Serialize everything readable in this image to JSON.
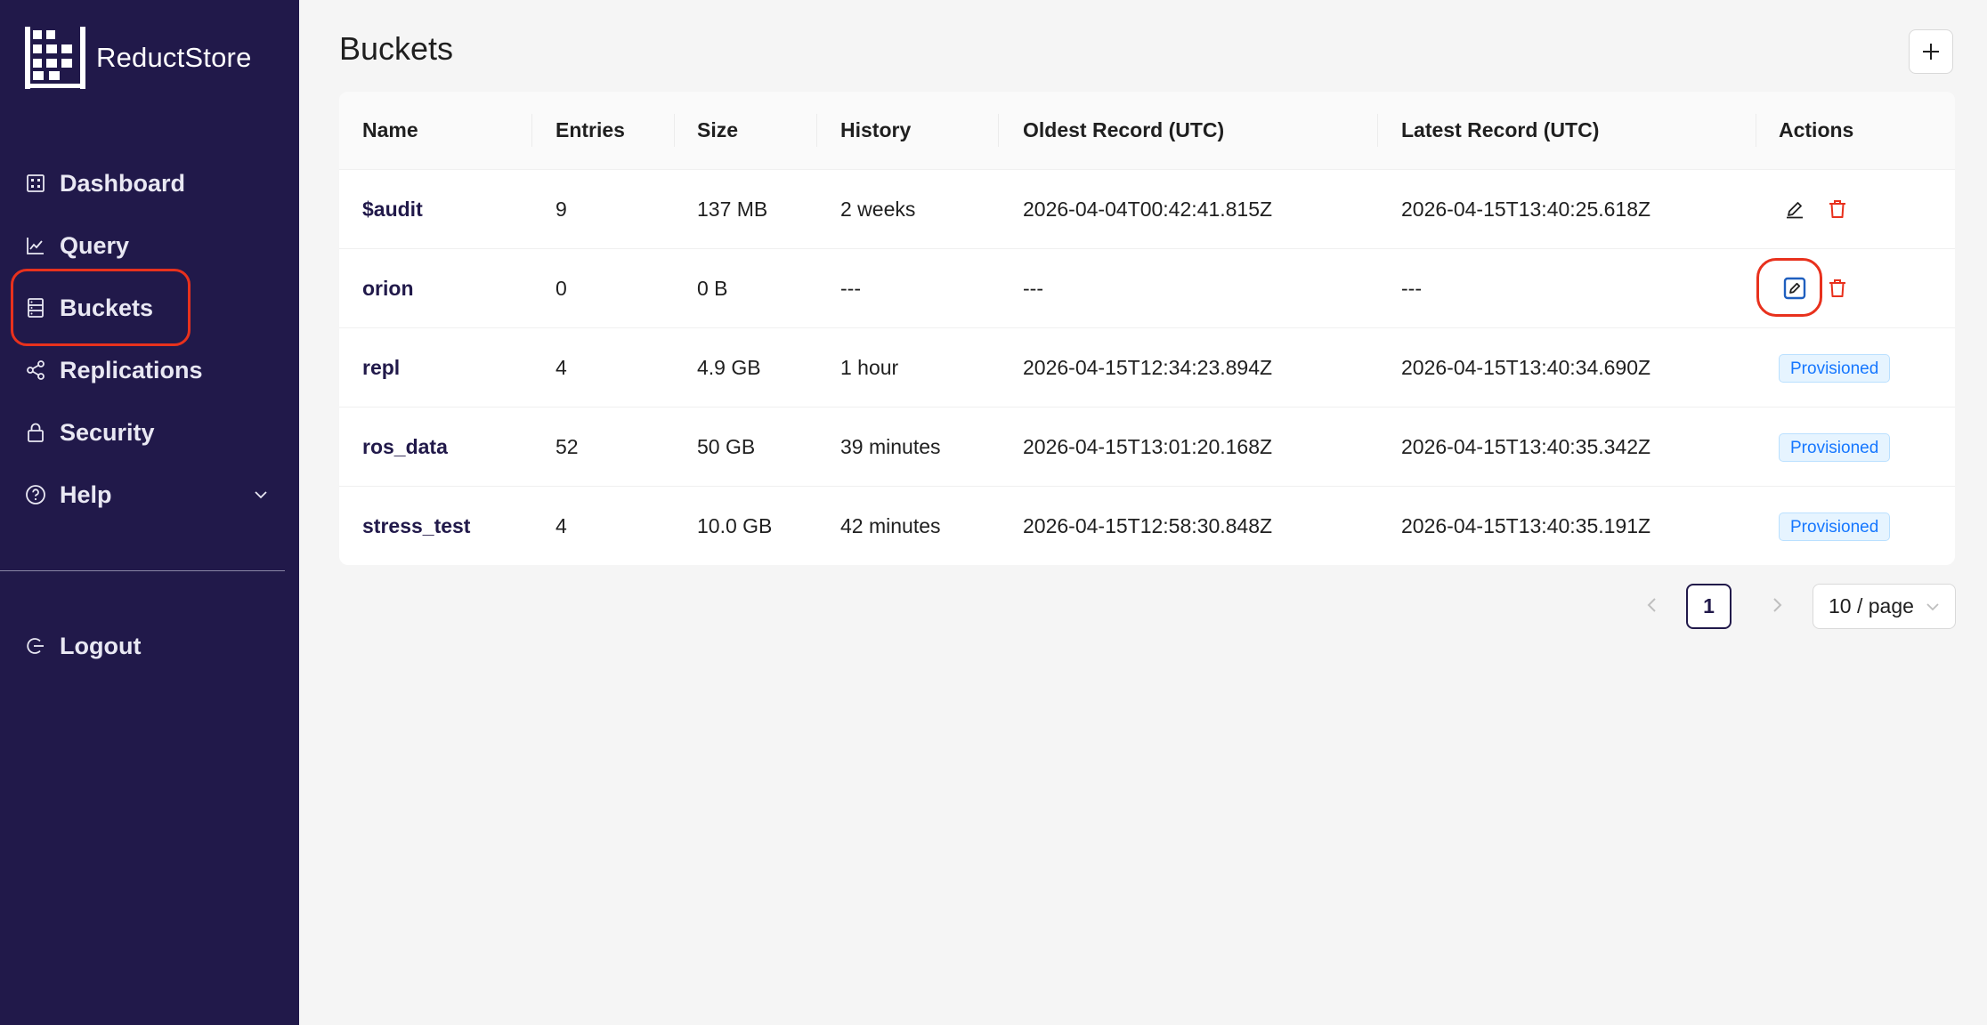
{
  "app": {
    "name": "ReductStore"
  },
  "sidebar": {
    "items": [
      {
        "label": "Dashboard",
        "icon": "dashboard-icon"
      },
      {
        "label": "Query",
        "icon": "line-chart-icon"
      },
      {
        "label": "Buckets",
        "icon": "database-icon"
      },
      {
        "label": "Replications",
        "icon": "share-icon"
      },
      {
        "label": "Security",
        "icon": "lock-icon"
      },
      {
        "label": "Help",
        "icon": "question-circle-icon"
      }
    ],
    "logout": {
      "label": "Logout",
      "icon": "logout-icon"
    },
    "highlighted": "Buckets"
  },
  "page": {
    "title": "Buckets"
  },
  "table": {
    "columns": [
      "Name",
      "Entries",
      "Size",
      "History",
      "Oldest Record (UTC)",
      "Latest Record (UTC)",
      "Actions"
    ],
    "rows": [
      {
        "name": "$audit",
        "entries": "9",
        "size": "137 MB",
        "history": "2 weeks",
        "oldest": "2026-04-04T00:42:41.815Z",
        "latest": "2026-04-15T13:40:25.618Z",
        "action": "edit-delete"
      },
      {
        "name": "orion",
        "entries": "0",
        "size": "0 B",
        "history": "---",
        "oldest": "---",
        "latest": "---",
        "action": "edit-delete"
      },
      {
        "name": "repl",
        "entries": "4",
        "size": "4.9 GB",
        "history": "1 hour",
        "oldest": "2026-04-15T12:34:23.894Z",
        "latest": "2026-04-15T13:40:34.690Z",
        "action": "Provisioned"
      },
      {
        "name": "ros_data",
        "entries": "52",
        "size": "50 GB",
        "history": "39 minutes",
        "oldest": "2026-04-15T13:01:20.168Z",
        "latest": "2026-04-15T13:40:35.342Z",
        "action": "Provisioned"
      },
      {
        "name": "stress_test",
        "entries": "4",
        "size": "10.0 GB",
        "history": "42 minutes",
        "oldest": "2026-04-15T12:58:30.848Z",
        "latest": "2026-04-15T13:40:35.191Z",
        "action": "Provisioned"
      }
    ]
  },
  "pagination": {
    "current_page": "1",
    "page_size": "10 / page"
  },
  "colors": {
    "sidebar_bg": "#21194a",
    "highlight": "#e8311d",
    "delete": "#e8311d",
    "edit_active": "#1f5fbf",
    "tag": "#1677ff"
  }
}
